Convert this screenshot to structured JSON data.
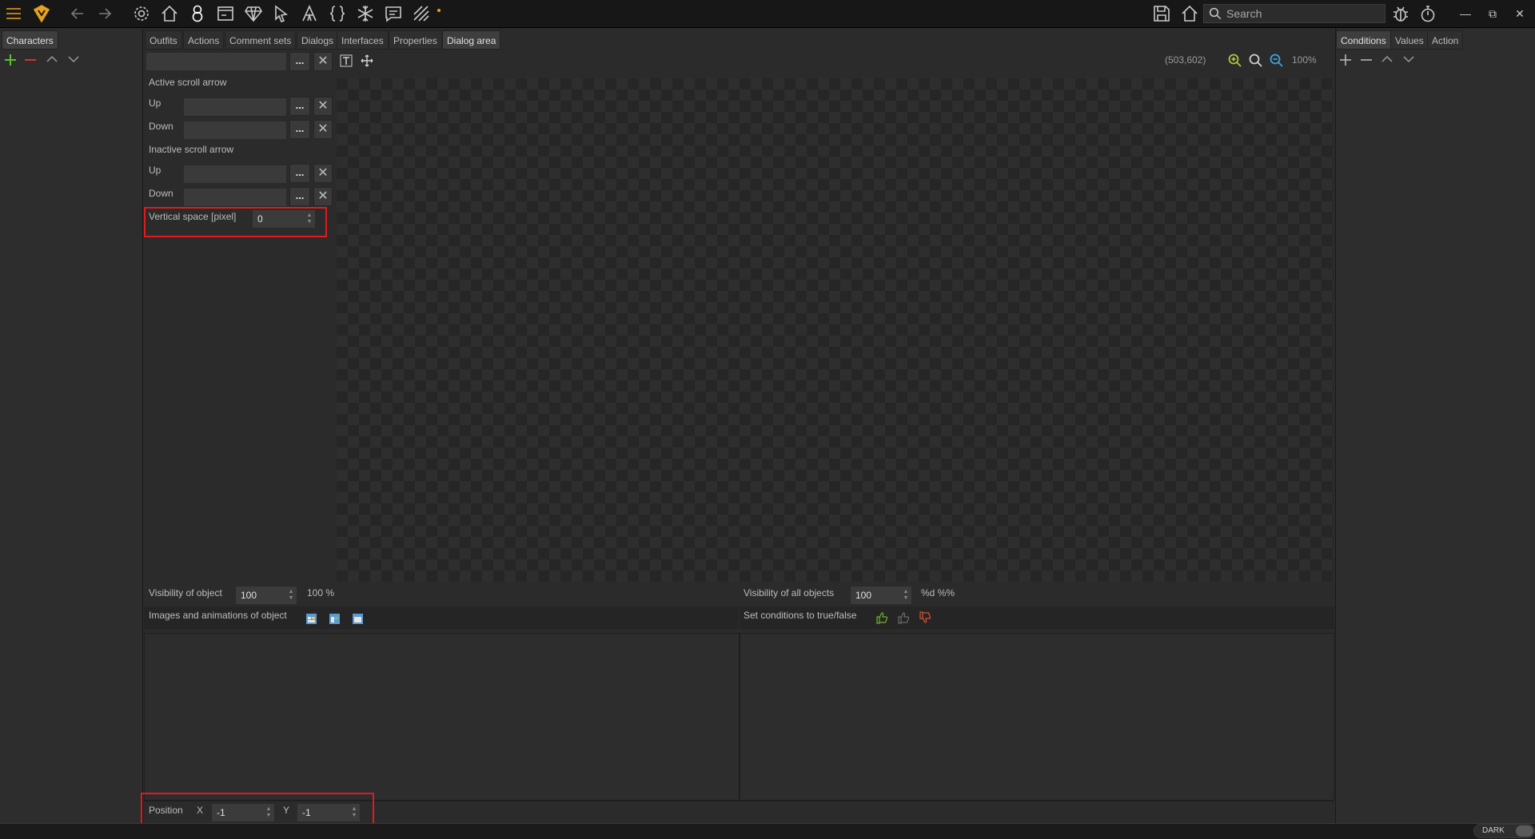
{
  "toolbar": {
    "icons": [
      "menu-icon",
      "logo-icon",
      "back-icon",
      "forward-icon",
      "settings-icon",
      "home-icon",
      "character-icon",
      "window-icon",
      "gem-icon",
      "cursor-icon",
      "font-icon",
      "script-braces-icon",
      "snowflake-icon",
      "dialog-icon",
      "stripes-icon"
    ],
    "search_placeholder": "Search",
    "right_icons": [
      "save-icon",
      "home-save-icon",
      "bug-icon",
      "stopwatch-icon"
    ]
  },
  "left_panel": {
    "tab": "Characters"
  },
  "center_tabs": [
    "Outfits",
    "Actions",
    "Comment sets",
    "Dialogs",
    "Interfaces",
    "Properties",
    "Dialog area"
  ],
  "active_center_tab": "Dialog area",
  "right_tabs": [
    "Conditions",
    "Values",
    "Action"
  ],
  "props": {
    "top_field_value": "",
    "dots": "...",
    "active_scroll_arrow": "Active scroll arrow",
    "inactive_scroll_arrow": "Inactive scroll arrow",
    "up": "Up",
    "down": "Down",
    "vertical_space_label": "Vertical space [pixel]",
    "vertical_space_value": "0"
  },
  "canvas": {
    "coords": "(503,602)",
    "zoom": "100%"
  },
  "visibility": {
    "object_label": "Visibility of object",
    "object_value": "100",
    "object_suffix": "100 %",
    "all_label": "Visibility of all objects",
    "all_value": "100",
    "all_suffix": "%d %%"
  },
  "sections": {
    "images_label": "Images and animations of object",
    "conditions_label": "Set conditions to true/false"
  },
  "position": {
    "label": "Position",
    "x_label": "X",
    "x_value": "-1",
    "y_label": "Y",
    "y_value": "-1"
  },
  "status": {
    "theme_label": "DARK"
  },
  "colors": {
    "accent_orange": "#e8a21c",
    "add_green": "#5fbf2a",
    "remove_red": "#e0302b",
    "highlight_red": "#e01b1b"
  }
}
